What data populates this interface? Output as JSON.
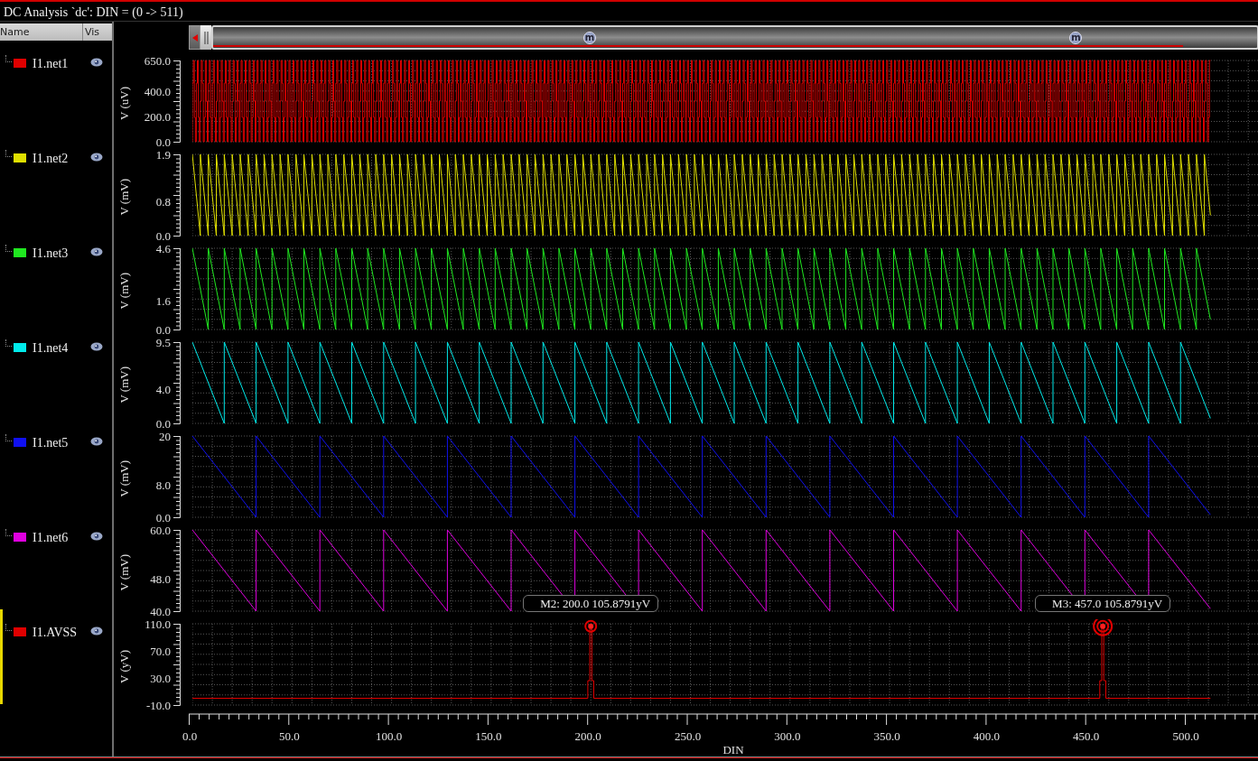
{
  "window": {
    "title": "DC Analysis `dc': DIN = (0 -> 511)"
  },
  "signal_list": {
    "columns": [
      "Name",
      "Vis"
    ]
  },
  "signals": [
    {
      "name": "I1.net1",
      "color": "#e00000",
      "selected": false,
      "kind": "pulses",
      "y_label": "V (uV)",
      "y_ticks": [
        "650.0",
        "400.0",
        "200.0",
        "0.0"
      ]
    },
    {
      "name": "I1.net2",
      "color": "#e0e000",
      "selected": false,
      "kind": "sawtooth",
      "y_label": "V (mV)",
      "y_ticks": [
        "1.9",
        "0.8",
        "0.0"
      ]
    },
    {
      "name": "I1.net3",
      "color": "#20e820",
      "selected": false,
      "kind": "sawtooth",
      "y_label": "V (mV)",
      "y_ticks": [
        "4.6",
        "1.6",
        "0.0"
      ]
    },
    {
      "name": "I1.net4",
      "color": "#00ecec",
      "selected": false,
      "kind": "sawtooth",
      "y_label": "V (mV)",
      "y_ticks": [
        "9.5",
        "4.0",
        "0.0"
      ]
    },
    {
      "name": "I1.net5",
      "color": "#1010f0",
      "selected": false,
      "kind": "sawtooth",
      "y_label": "V (mV)",
      "y_ticks": [
        "20",
        "8.0",
        "0.0"
      ]
    },
    {
      "name": "I1.net6",
      "color": "#e000e0",
      "selected": false,
      "kind": "sawtooth",
      "y_label": "V (mV)",
      "y_ticks": [
        "60.0",
        "48.0",
        "40.0"
      ]
    },
    {
      "name": "I1.AVSS",
      "color": "#e00000",
      "selected": true,
      "kind": "spike",
      "y_label": "V (yV)",
      "y_ticks": [
        "110.0",
        "70.0",
        "30.0",
        "-10.0"
      ],
      "markers": [
        {
          "label": "M2: 200.0 105.8791yV",
          "handle": "m",
          "active": false
        },
        {
          "label": "M3: 457.0 105.8791yV",
          "handle": "m",
          "active": true
        }
      ]
    }
  ],
  "x_axis": {
    "title": "DIN",
    "ticks": [
      "0.0",
      "50.0",
      "100.0",
      "150.0",
      "200.0",
      "250.0",
      "300.0",
      "350.0",
      "400.0",
      "450.0",
      "500.0"
    ]
  }
}
